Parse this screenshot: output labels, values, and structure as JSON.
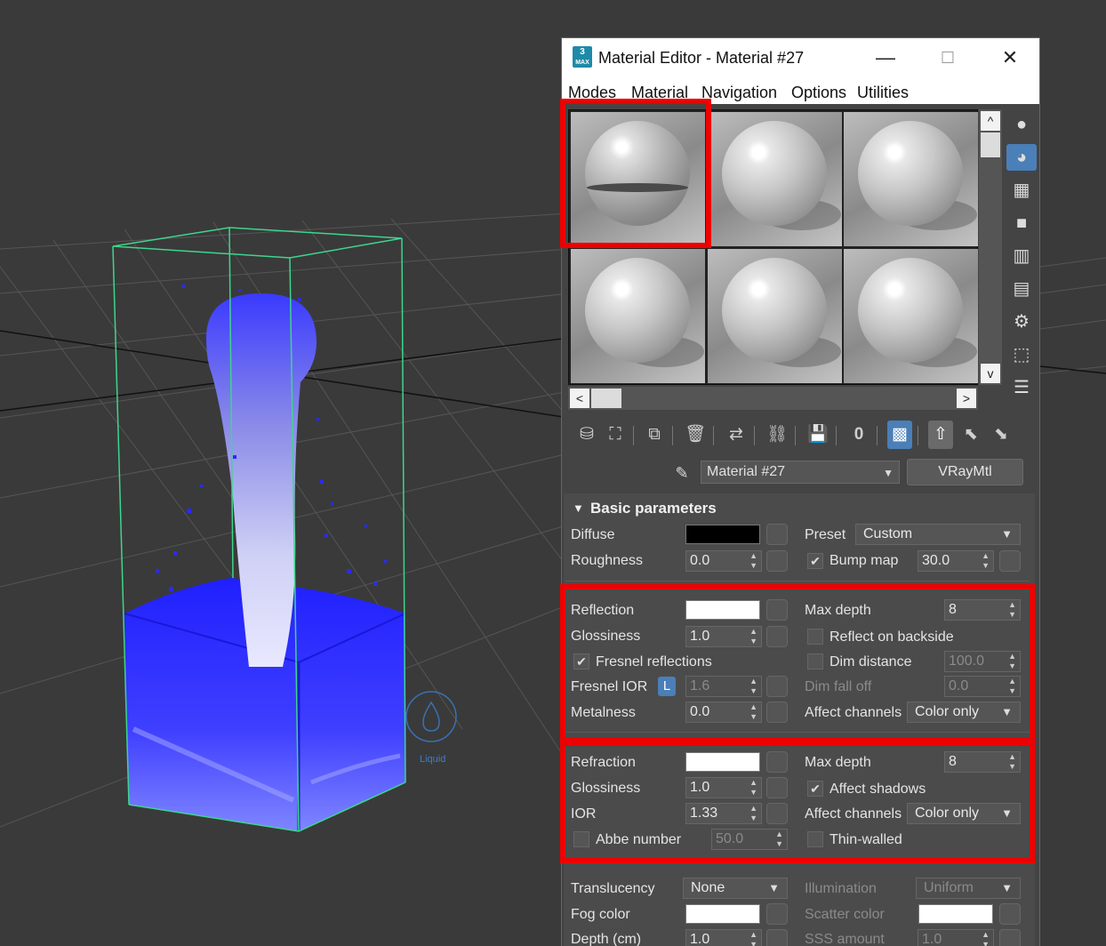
{
  "window": {
    "title": "Material Editor - Material #27",
    "app_icon_text": "3",
    "app_icon_sub": "MAX",
    "minimize": "—",
    "maximize": "☐",
    "close": "✕"
  },
  "menu": [
    "Modes",
    "Material",
    "Navigation",
    "Options",
    "Utilities"
  ],
  "viewport": {
    "icon_label": "Liquid"
  },
  "slots": {
    "scroll_up": "^",
    "scroll_down": "v",
    "scroll_left": "<",
    "scroll_right": ">"
  },
  "sidebar_tools": [
    "sample-type-sphere-icon",
    "backlight-icon",
    "background-checker-icon",
    "sample-uv-tiling-icon",
    "video-color-check-icon",
    "make-preview-icon",
    "options-icon",
    "select-by-material-icon",
    "material-map-navigator-icon"
  ],
  "toolbar": {
    "buttons": [
      "get-material-icon",
      "put-to-scene-icon",
      "assign-to-selection-icon",
      "reset-map-icon",
      "make-unique-icon",
      "put-to-library-icon",
      "material-id-channel-icon",
      "show-map-in-viewport-icon",
      "show-end-result-icon",
      "go-to-parent-icon",
      "go-forward-to-sibling-icon"
    ],
    "material_id": "0"
  },
  "material": {
    "name": "Material #27",
    "type": "VRayMtl"
  },
  "rollout": {
    "title": "Basic parameters",
    "diffuse": {
      "label": "Diffuse",
      "color": "#000000"
    },
    "roughness": {
      "label": "Roughness",
      "value": "0.0"
    },
    "preset": {
      "label": "Preset",
      "value": "Custom"
    },
    "bump_map": {
      "label": "Bump map",
      "value": "30.0",
      "checked": true
    },
    "reflection": {
      "label": "Reflection",
      "color": "#ffffff",
      "glossiness_label": "Glossiness",
      "glossiness": "1.0",
      "fresnel_label": "Fresnel reflections",
      "fresnel_checked": true,
      "fresnel_ior_label": "Fresnel IOR",
      "lock_label": "L",
      "fresnel_ior": "1.6",
      "metalness_label": "Metalness",
      "metalness": "0.0",
      "max_depth_label": "Max depth",
      "max_depth": "8",
      "backside_label": "Reflect on backside",
      "dim_distance_label": "Dim distance",
      "dim_distance": "100.0",
      "dim_falloff_label": "Dim fall off",
      "dim_falloff": "0.0",
      "affect_channels_label": "Affect channels",
      "affect_channels": "Color only"
    },
    "refraction": {
      "label": "Refraction",
      "color": "#ffffff",
      "glossiness_label": "Glossiness",
      "glossiness": "1.0",
      "ior_label": "IOR",
      "ior": "1.33",
      "abbe_label": "Abbe number",
      "abbe": "50.0",
      "max_depth_label": "Max depth",
      "max_depth": "8",
      "affect_shadows_label": "Affect shadows",
      "affect_shadows_checked": true,
      "affect_channels_label": "Affect channels",
      "affect_channels": "Color only",
      "thin_walled_label": "Thin-walled"
    },
    "translucency": {
      "label": "Translucency",
      "value": "None"
    },
    "illumination": {
      "label": "Illumination",
      "value": "Uniform"
    },
    "fog_color": {
      "label": "Fog color",
      "color": "#ffffff"
    },
    "scatter_color": {
      "label": "Scatter color",
      "color": "#ffffff"
    },
    "depth": {
      "label": "Depth (cm)",
      "value": "1.0"
    },
    "sss_amount": {
      "label": "SSS amount",
      "value": "1.0"
    }
  },
  "colors": {
    "highlight": "#ee0000",
    "liquid": "#2a2aff",
    "bbox": "#3dd68c",
    "accent": "#4a7fb8"
  }
}
